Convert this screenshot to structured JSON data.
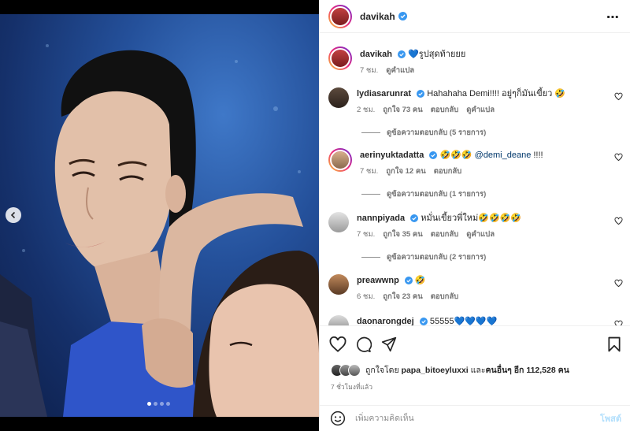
{
  "post": {
    "author": "davikah",
    "caption_emoji": "💙",
    "caption": "รูปสุดท้ายยย",
    "caption_time": "7 ชม.",
    "caption_translate": "ดูคำแปล",
    "more_icon": "⋯"
  },
  "media": {
    "prev_icon": "chevron-left-icon",
    "dots": 4,
    "active_dot": 0
  },
  "comments": [
    {
      "user": "lydiasarunrat",
      "text": "Hahahaha Demi!!!! อยู่ๆก็มันเขี้ยว 🤣",
      "time": "2 ชม.",
      "likes": "ถูกใจ 73 คน",
      "reply": "ตอบกลับ",
      "translate": "ดูคำแปล",
      "replies": "ดูข้อความตอบกลับ (5 รายการ)"
    },
    {
      "user": "aerinyuktadatta",
      "text_before": "🤣🤣🤣 ",
      "mention": "@demi_deane",
      "text_after": " !!!!",
      "time": "7 ชม.",
      "likes": "ถูกใจ 12 คน",
      "reply": "ตอบกลับ",
      "replies": "ดูข้อความตอบกลับ (1 รายการ)"
    },
    {
      "user": "nannpiyada",
      "text": "หมั่นเขี้ยวพี่ใหม่🤣🤣🤣🤣",
      "time": "7 ชม.",
      "likes": "ถูกใจ 35 คน",
      "reply": "ตอบกลับ",
      "translate": "ดูคำแปล",
      "replies": "ดูข้อความตอบกลับ (2 รายการ)"
    },
    {
      "user": "preawwnp",
      "text": "🤣",
      "time": "6 ชม.",
      "likes": "ถูกใจ 23 คน",
      "reply": "ตอบกลับ"
    },
    {
      "user": "daonarongdej",
      "text": "55555💙💙💙💙"
    }
  ],
  "actions": {
    "liked_by_prefix": "ถูกใจโดย",
    "liked_by_user": "papa_bitoeyluxxi",
    "liked_by_and": "และ",
    "liked_by_others": "คนอื่นๆ อีก 112,528 คน",
    "time_ago": "7 ชั่วโมงที่แล้ว"
  },
  "compose": {
    "placeholder": "เพิ่มความคิดเห็น",
    "post_label": "โพสต์"
  },
  "colors": {
    "verified": "#3897f0",
    "link_muted": "#737373",
    "post_button_disabled": "#b2dffc"
  }
}
